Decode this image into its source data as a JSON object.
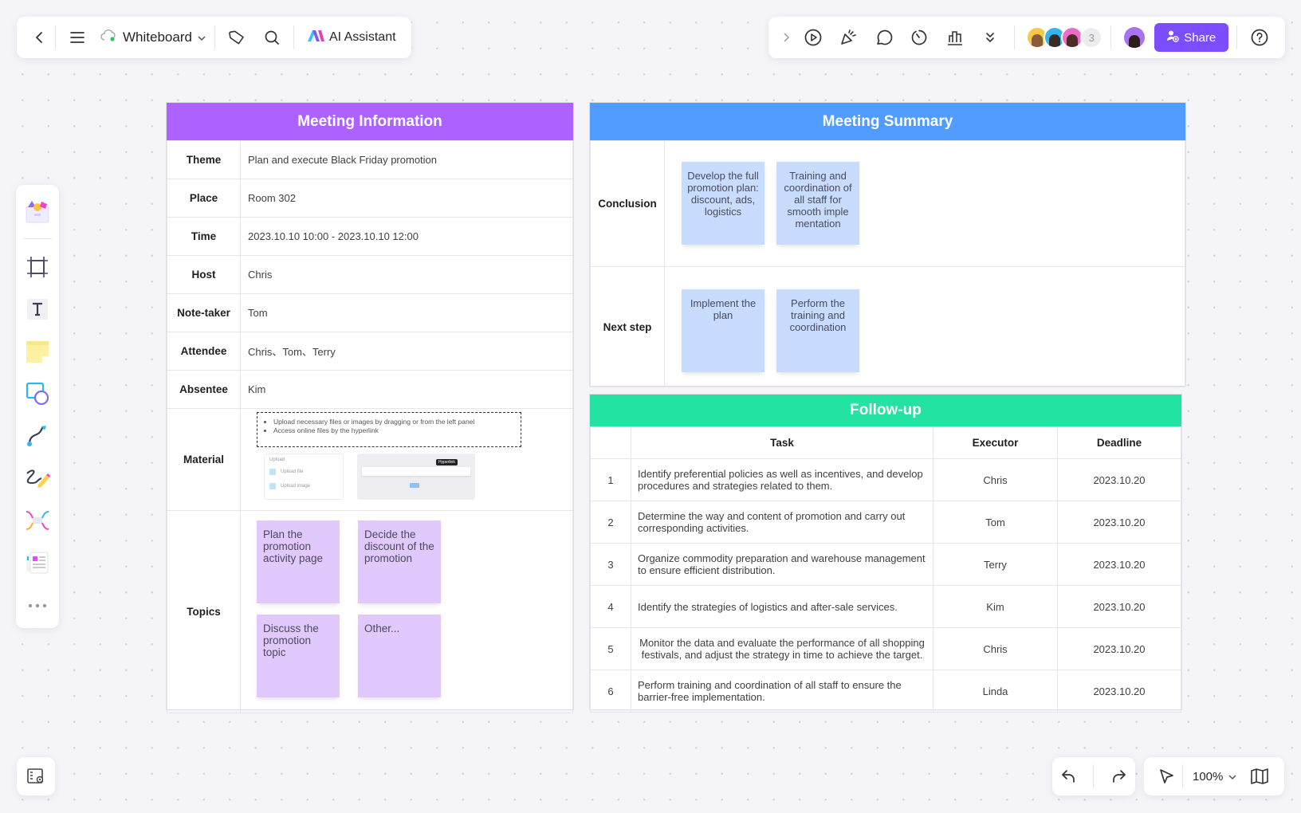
{
  "toolbar_left": {
    "back_icon": "chevron-left-icon",
    "menu_icon": "hamburger-icon",
    "doc_title": "Whiteboard",
    "sync_icon": "cloud-synced-icon",
    "tag_icon": "tag-icon",
    "search_icon": "search-icon",
    "ai_assistant_label": "AI Assistant"
  },
  "toolbar_right": {
    "icons": [
      "expand-chevron-icon",
      "present-play-icon",
      "celebrate-icon",
      "comment-icon",
      "timer-icon",
      "vote-chart-icon",
      "more-chevrons-icon"
    ],
    "collaborator_count": "3",
    "share_label": "Share",
    "help_icon": "help-icon"
  },
  "tool_rail": [
    "templates",
    "frame",
    "text",
    "sticky-note",
    "shapes",
    "connector",
    "pen",
    "mind-map",
    "cards",
    "more"
  ],
  "bottom": {
    "zoom_level": "100%"
  },
  "meeting_info": {
    "title": "Meeting Information",
    "rows": [
      {
        "label": "Theme",
        "value": "Plan and execute Black Friday promotion"
      },
      {
        "label": "Place",
        "value": "Room 302"
      },
      {
        "label": "Time",
        "value": "2023.10.10 10:00 - 2023.10.10 12:00"
      },
      {
        "label": "Host",
        "value": "Chris"
      },
      {
        "label": "Note-taker",
        "value": "Tom"
      },
      {
        "label": "Attendee",
        "value": "Chris、Tom、Terry"
      },
      {
        "label": "Absentee",
        "value": "Kim"
      }
    ],
    "material": {
      "label": "Material",
      "bullets": [
        "Upload necessary files or images by dragging or from the left panel",
        "Access online files by the hyperlink"
      ],
      "upload_panel": {
        "title": "Upload",
        "items": [
          "Upload file",
          "Upload image"
        ]
      },
      "hyperlink_tooltip": "Hyperlink"
    },
    "topics": {
      "label": "Topics",
      "notes": [
        "Plan the promotion activity page",
        "Decide the discount of the promotion",
        "Discuss the promotion topic",
        "Other..."
      ]
    }
  },
  "meeting_summary": {
    "title": "Meeting Summary",
    "conclusion": {
      "label": "Conclusion",
      "notes": [
        "Develop the full promotion plan: discount, ads, logistics",
        "Training and coordination of all staff for smooth imple mentation"
      ]
    },
    "next_step": {
      "label": "Next step",
      "notes": [
        "Implement the plan",
        "Perform the training and coordination"
      ]
    }
  },
  "followup": {
    "title": "Follow-up",
    "columns": [
      "",
      "Task",
      "Executor",
      "Deadline"
    ],
    "rows": [
      {
        "no": "1",
        "task": "Identify preferential policies as well as incentives, and develop procedures and strategies related to them.",
        "executor": "Chris",
        "deadline": "2023.10.20"
      },
      {
        "no": "2",
        "task": "Determine the way and content of promotion and carry out corresponding activities.",
        "executor": "Tom",
        "deadline": "2023.10.20"
      },
      {
        "no": "3",
        "task": "Organize commodity preparation and warehouse management to ensure efficient distribution.",
        "executor": "Terry",
        "deadline": "2023.10.20"
      },
      {
        "no": "4",
        "task": "Identify the strategies of logistics and after-sale services.",
        "executor": "Kim",
        "deadline": "2023.10.20"
      },
      {
        "no": "5",
        "task": "Monitor the data and evaluate the performance of all shopping festivals, and adjust the strategy in time to achieve the target.",
        "executor": "Chris",
        "deadline": "2023.10.20"
      },
      {
        "no": "6",
        "task": "Perform training and coordination of all staff to ensure the barrier-free implementation.",
        "executor": "Linda",
        "deadline": "2023.10.20"
      }
    ]
  },
  "colors": {
    "info_header": "#ad62ff",
    "summary_header": "#519cff",
    "followup_header": "#22e3a1",
    "share_button": "#7c4dff",
    "sticky_purple": "#e1c9fd",
    "sticky_blue": "#c8dcff"
  }
}
